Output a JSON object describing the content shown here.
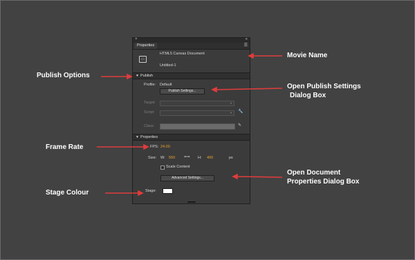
{
  "panel": {
    "tab_label": "Properties",
    "doc_type": "HTML5 Canvas Document",
    "doc_name": "Untitled-1",
    "publish_section": "Publish",
    "profile_label": "Profile:",
    "profile_value": "Default",
    "publish_settings_button": "Publish Settings...",
    "target_label": "Target:",
    "script_label": "Script:",
    "class_label": "Class:",
    "properties_section": "Properties",
    "fps_label": "FPS:",
    "fps_value": "24.00",
    "size_label": "Size:",
    "w_label": "W:",
    "w_value": "550",
    "h_label": "H:",
    "h_value": "400",
    "unit": "px",
    "scale_content_label": "Scale Content",
    "advanced_settings_button": "Advanced Settings...",
    "stage_label": "Stage:",
    "stage_color": "#ffffff"
  },
  "annotations": {
    "movie_name": "Movie Name",
    "publish_options": "Publish Options",
    "open_publish_line1": "Open Publish Settings",
    "open_publish_line2": "Dialog Box",
    "frame_rate": "Frame Rate",
    "open_doc_line1": "Open Document",
    "open_doc_line2": "Properties Dialog Box",
    "stage_colour": "Stage Colour"
  },
  "colors": {
    "background": "#424242",
    "panel": "#3b3b3b",
    "arrow": "#e03c3c",
    "value_accent": "#e8a32a"
  }
}
